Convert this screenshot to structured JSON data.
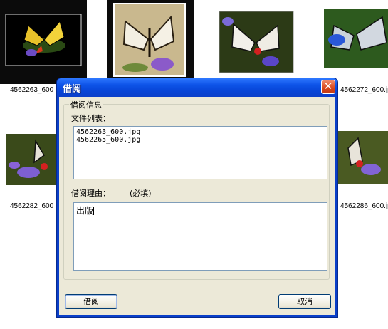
{
  "thumbnails": {
    "row1": [
      {
        "caption": "4562263_600",
        "selected": true
      },
      {
        "caption": ""
      },
      {
        "caption": ""
      },
      {
        "caption": "4562272_600.jp"
      }
    ],
    "row2": [
      {
        "caption": "4562282_600"
      },
      {
        "caption": "4562286_600.jp"
      }
    ]
  },
  "dialog": {
    "title": "借阅",
    "group_title": "借阅信息",
    "file_list_label": "文件列表：",
    "files": [
      "4562263_600.jpg",
      "4562265_600.jpg"
    ],
    "reason_label": "借阅理由：",
    "required_hint": "(必填)",
    "reason_value": "出版",
    "ok_label": "借阅",
    "cancel_label": "取消"
  },
  "colors": {
    "titlebar": "#0a3fc9",
    "client": "#ece9d8",
    "close": "#d8461a"
  }
}
